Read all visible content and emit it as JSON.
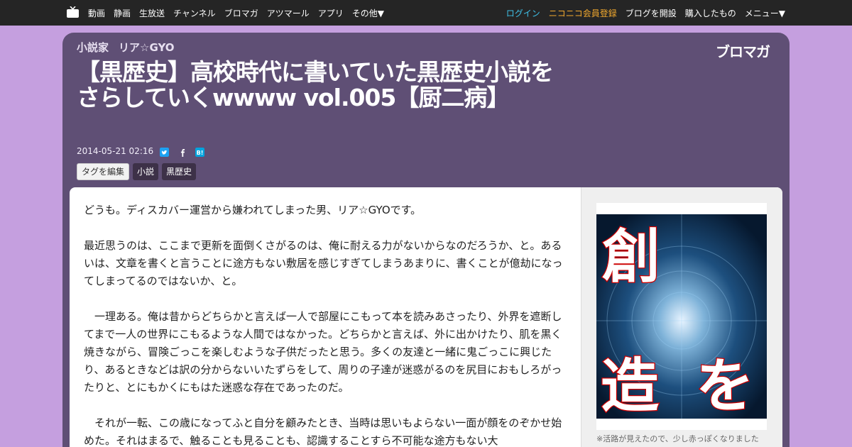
{
  "nav": {
    "left": [
      "動画",
      "静画",
      "生放送",
      "チャンネル",
      "ブロマガ",
      "アツマール",
      "アプリ",
      "その他▼"
    ],
    "login": "ログイン",
    "register": "ニコニコ会員登録",
    "open_blog": "ブログを開設",
    "purchased": "購入したもの",
    "menu": "メニュー▼"
  },
  "header": {
    "author_type": "小説家",
    "author_name": "リア☆GYO",
    "brand": "ブロマガ",
    "title": "【黒歴史】高校時代に書いていた黒歴史小説をさらしていくwwww vol.005【厨二病】",
    "date": "2014-05-21 02:16",
    "share_icons": [
      "twitter-icon",
      "facebook-icon",
      "hatena-bookmark-icon"
    ]
  },
  "tags": {
    "edit_label": "タグを編集",
    "items": [
      "小説",
      "黒歴史"
    ]
  },
  "article": {
    "paragraphs": [
      "どうも。ディスカバー運営から嫌われてしまった男、リア☆GYOです。",
      "最近思うのは、ここまで更新を面倒くさがるのは、俺に耐える力がないからなのだろうか、と。あるいは、文章を書くと言うことに途方もない敷居を感じすぎてしまうあまりに、書くことが億劫になってしまってるのではないか、と。",
      "　一理ある。俺は昔からどちらかと言えば一人で部屋にこもって本を読みあさったり、外界を遮断してまで一人の世界にこもるような人間ではなかった。どちらかと言えば、外に出かけたり、肌を黒く焼きながら、冒険ごっこを楽しむような子供だったと思う。多くの友達と一緒に鬼ごっこに興じたり、あるときなどは訳の分からないいたずらをして、周りの子達が迷惑がるのを尻目におもしろがったりと、とにもかくにもはた迷惑な存在であったのだ。",
      "　それが一転、この歳になってふと自分を顧みたとき、当時は思いもよらない一面が顔をのぞかせ始めた。それはまるで、触ることも見ることも、認識することすら不可能な途方もない大"
    ]
  },
  "sidebar": {
    "image_text": [
      "創",
      "造",
      "を"
    ],
    "caption": "※活路が見えたので、少し赤っぽくなりました"
  },
  "colors": {
    "page_bg": "#c59fdf",
    "header_bg": "#5f4f75",
    "nav_bg": "#252525",
    "login": "#3fc1e8",
    "register": "#f2a92e"
  }
}
